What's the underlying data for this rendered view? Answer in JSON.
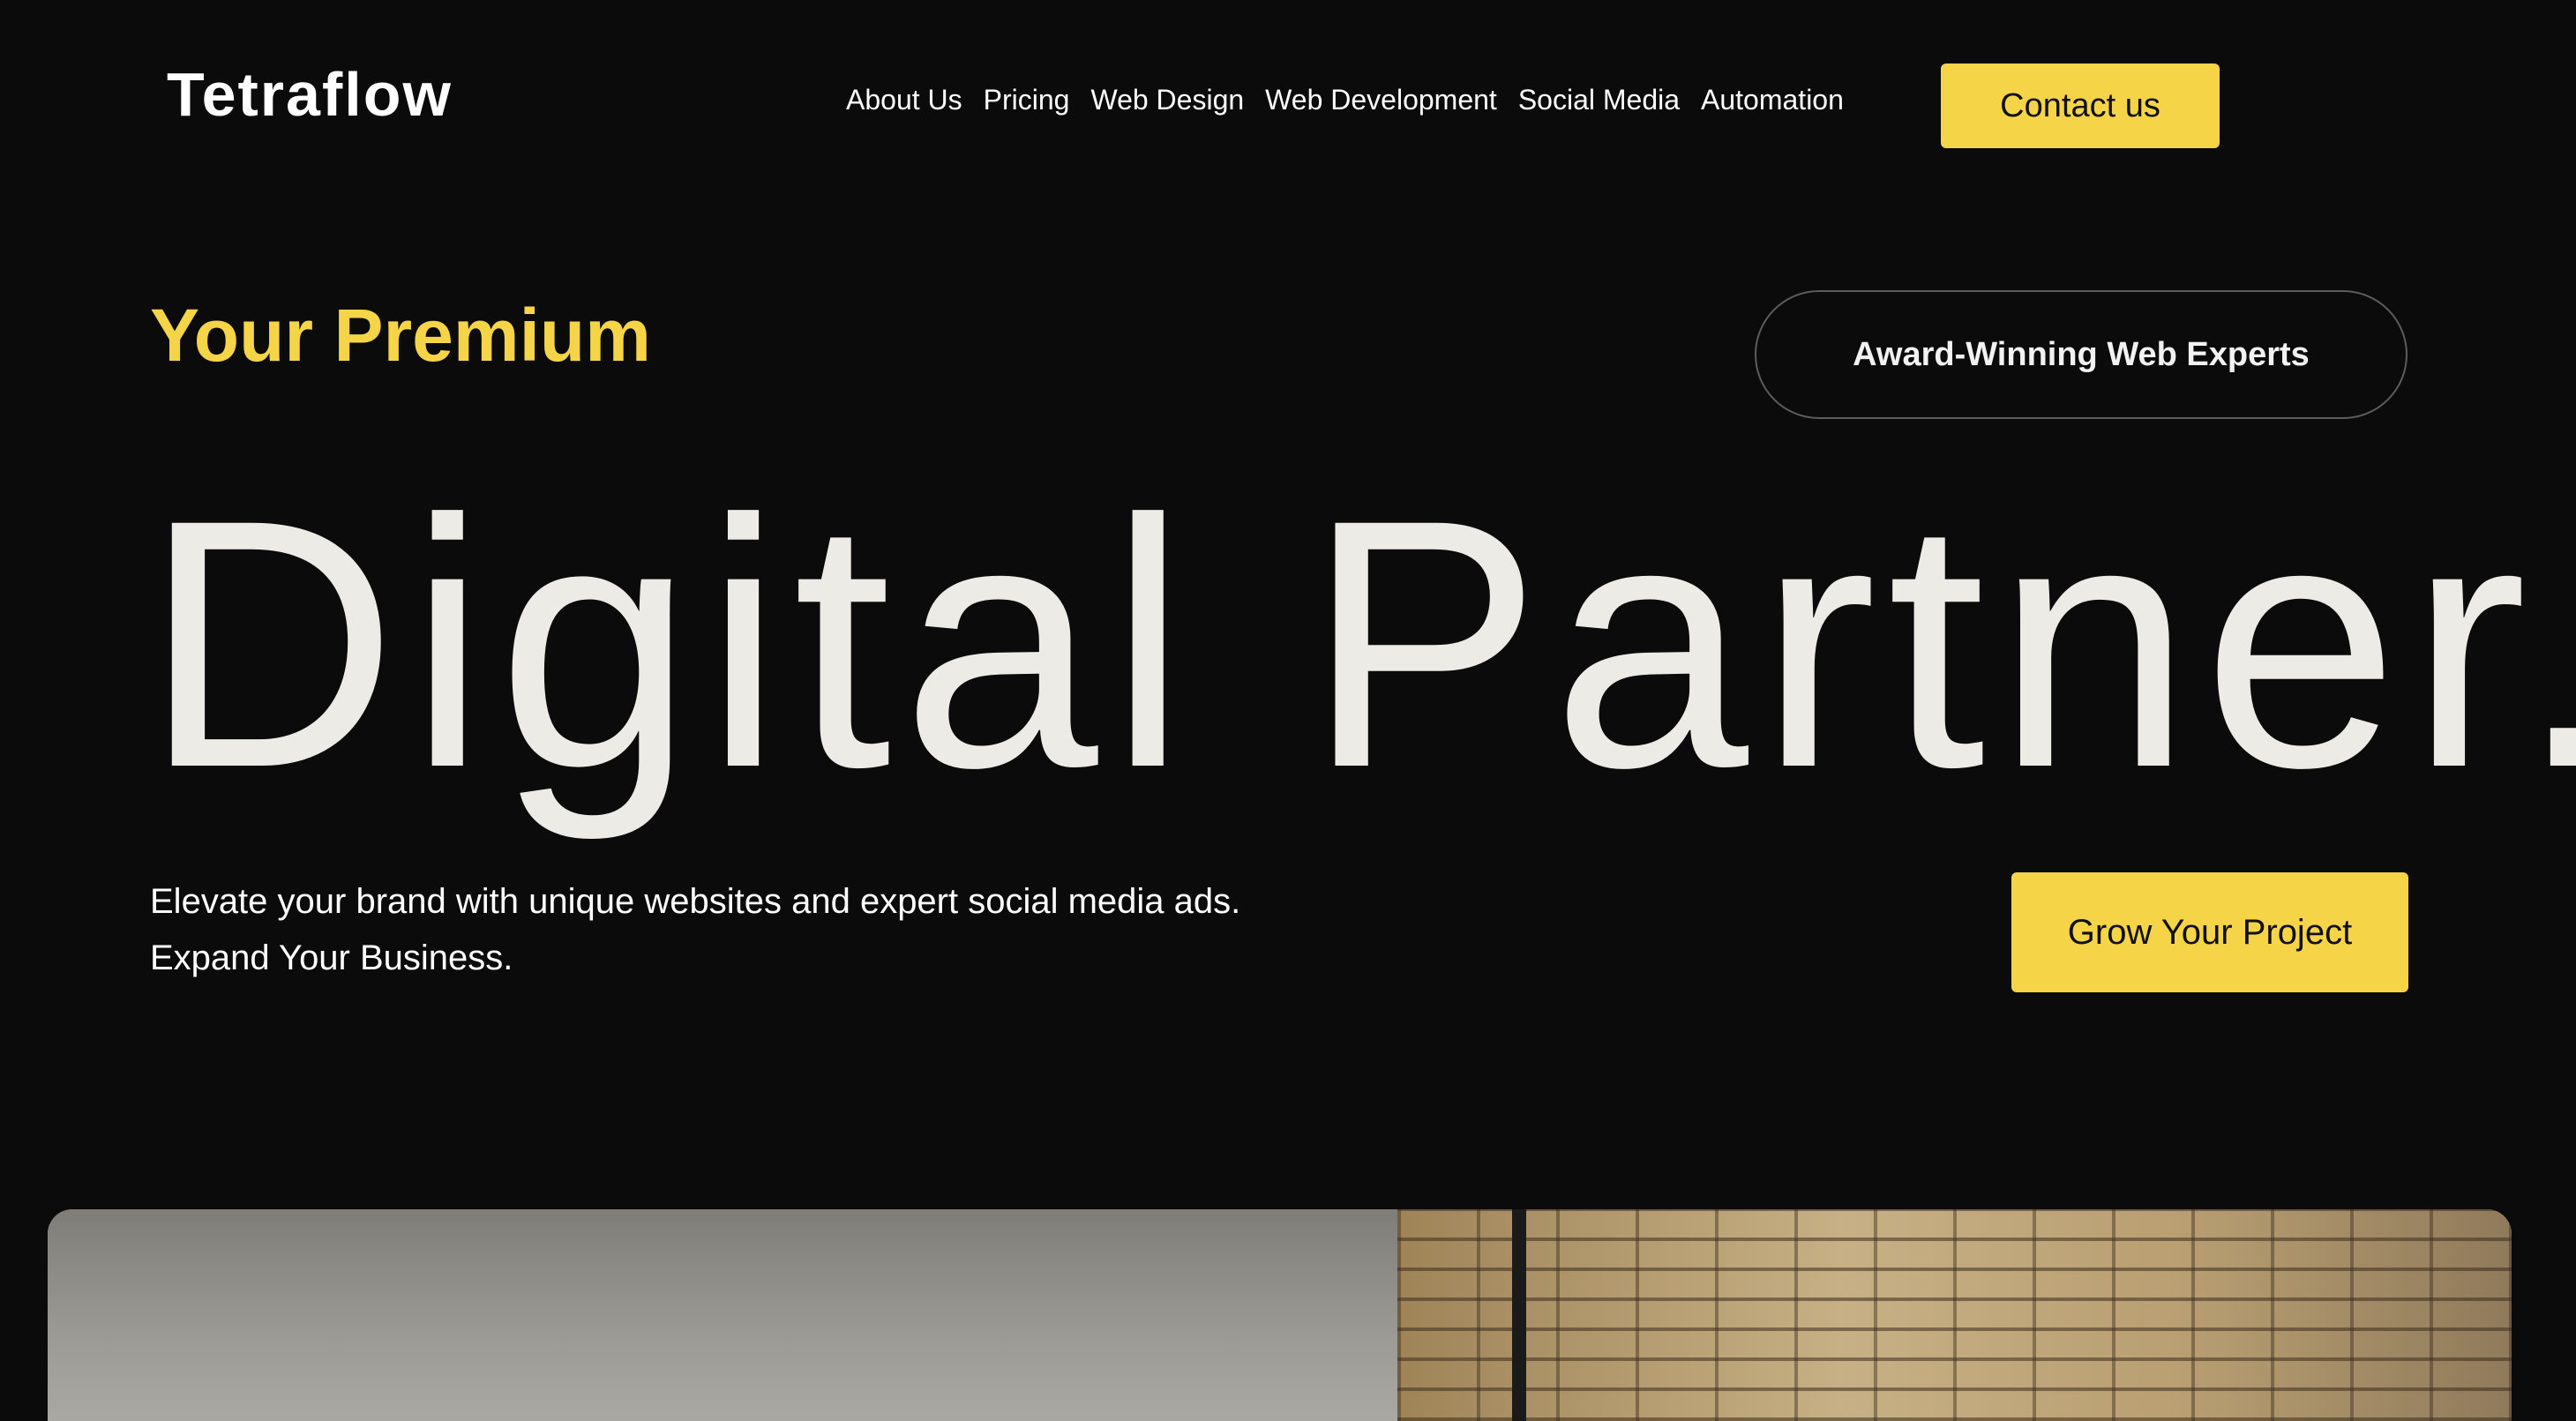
{
  "brand": {
    "logo": "Tetraflow"
  },
  "nav": {
    "items": [
      {
        "label": "About Us"
      },
      {
        "label": "Pricing"
      },
      {
        "label": "Web Design"
      },
      {
        "label": "Web Development"
      },
      {
        "label": "Social Media"
      },
      {
        "label": "Automation"
      }
    ],
    "contact_label": "Contact us"
  },
  "hero": {
    "eyebrow": "Your Premium",
    "badge": "Award-Winning Web Experts",
    "headline": "Digital Partner.",
    "tagline": "Elevate your brand with unique websites and expert social media ads. Expand Your Business.",
    "cta_label": "Grow Your Project"
  },
  "colors": {
    "background": "#0b0b0b",
    "accent": "#f5d547",
    "headline": "#ecebe6",
    "text": "#ffffff"
  },
  "icons": [],
  "image": {
    "description_hidden": ""
  }
}
